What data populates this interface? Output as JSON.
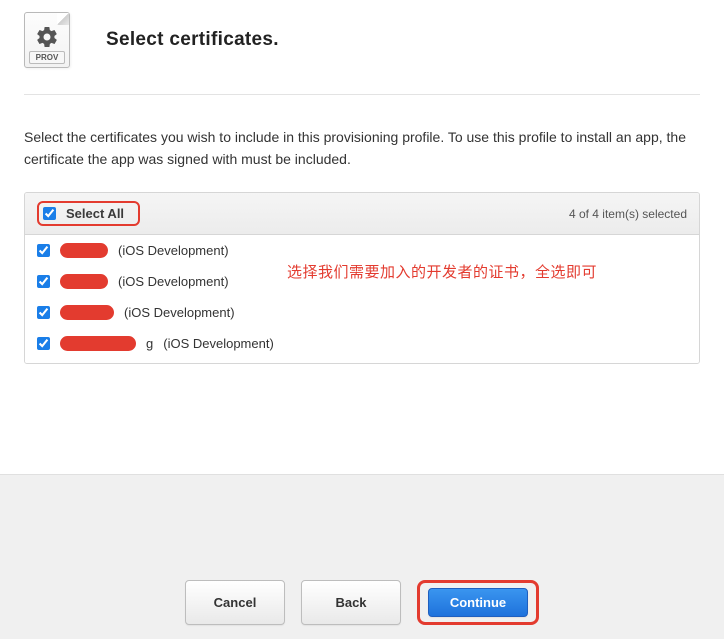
{
  "header": {
    "icon_tag": "PROV",
    "title": "Select certificates."
  },
  "instructions": "Select the certificates you wish to include in this provisioning profile. To use this profile to install an app, the certificate the app was signed with must be included.",
  "cert_panel": {
    "select_all_label": "Select All",
    "select_all_checked": true,
    "count_label": "4  of 4 item(s) selected",
    "items": [
      {
        "checked": true,
        "name_redacted": true,
        "suffix": "(iOS Development)",
        "redact_w": 48
      },
      {
        "checked": true,
        "name_redacted": true,
        "suffix": "(iOS Development)",
        "redact_w": 48
      },
      {
        "checked": true,
        "name_redacted": true,
        "suffix": "(iOS Development)",
        "redact_w": 54
      },
      {
        "checked": true,
        "name_redacted": true,
        "suffix": "(iOS Development)",
        "redact_w": 76,
        "partial_letter": "g "
      }
    ]
  },
  "annotation_text": "选择我们需要加入的开发者的证书，全选即可",
  "buttons": {
    "cancel": "Cancel",
    "back": "Back",
    "continue": "Continue"
  },
  "colors": {
    "highlight": "#e33b2f",
    "primary": "#1e72dc"
  }
}
